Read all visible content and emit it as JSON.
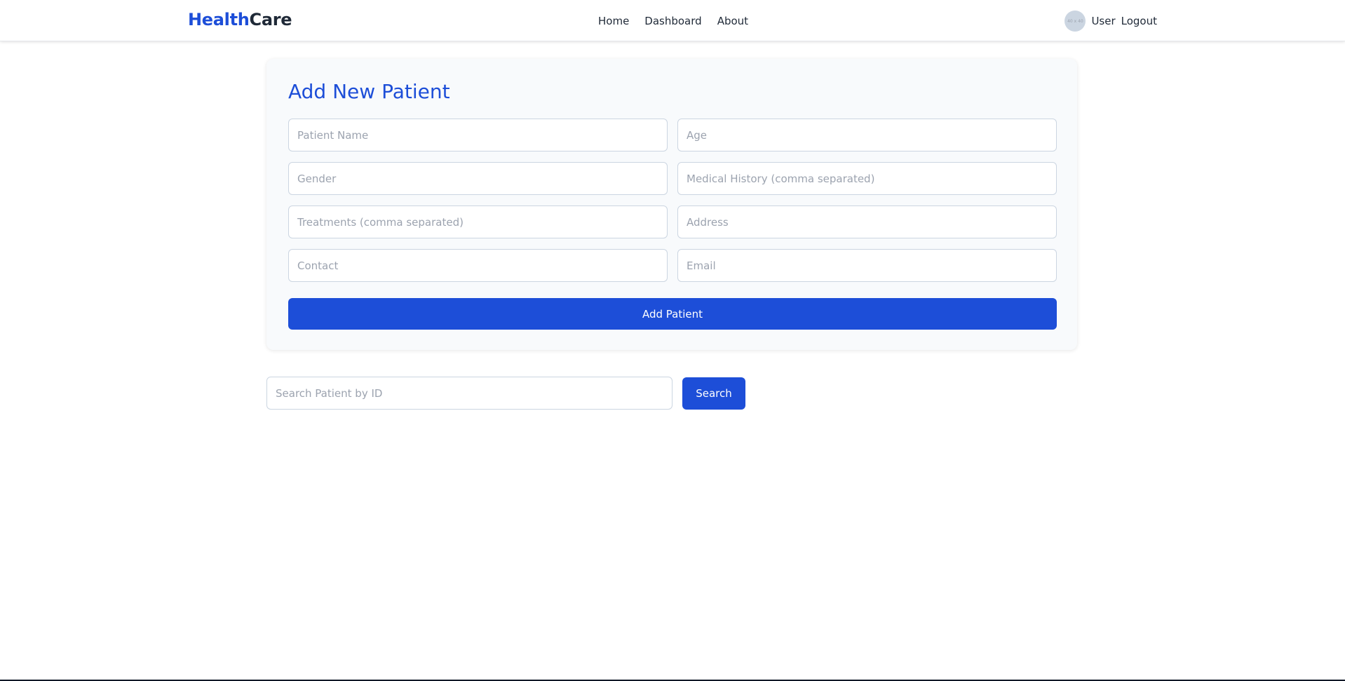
{
  "header": {
    "brand_part1": "Health",
    "brand_part2": "Care",
    "nav": [
      "Home",
      "Dashboard",
      "About"
    ],
    "avatar_text": "40 x 40",
    "user_label": "User",
    "logout_label": "Logout"
  },
  "form": {
    "title": "Add New Patient",
    "fields": {
      "patient_name": "Patient Name",
      "age": "Age",
      "gender": "Gender",
      "medical_history": "Medical History (comma separated)",
      "treatments": "Treatments (comma separated)",
      "address": "Address",
      "contact": "Contact",
      "email": "Email"
    },
    "submit_label": "Add Patient"
  },
  "search": {
    "placeholder": "Search Patient by ID",
    "button_label": "Search"
  },
  "colors": {
    "primary": "#1d4ed8",
    "card_bg": "#f8fafc",
    "border": "#cbd5e1",
    "placeholder": "#9ca3af"
  }
}
